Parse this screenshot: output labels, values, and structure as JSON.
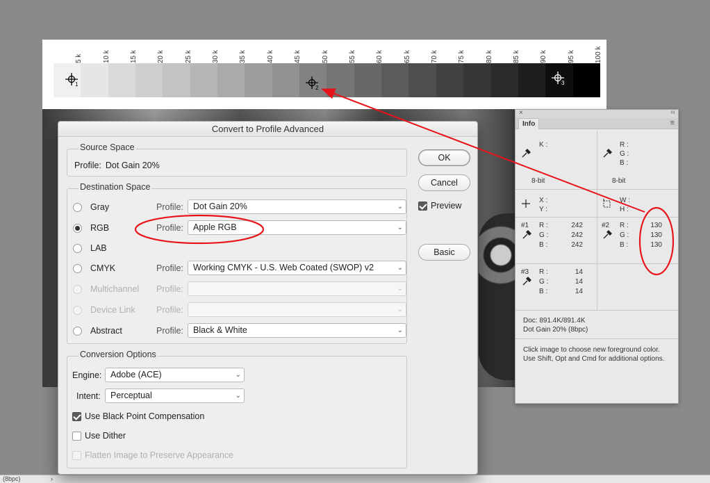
{
  "document": {
    "wedge_labels": [
      "5 k",
      "10 k",
      "15 k",
      "20 k",
      "25 k",
      "30 k",
      "35 k",
      "40 k",
      "45 k",
      "50 k",
      "55 k",
      "60 k",
      "65 k",
      "70 k",
      "75 k",
      "80 k",
      "85 k",
      "90 k",
      "95 k",
      "100 k"
    ],
    "wedge_grays": [
      "#f0f0f0",
      "#e6e6e6",
      "#dadada",
      "#cecece",
      "#c3c3c3",
      "#b6b6b6",
      "#aaaaaa",
      "#9d9d9d",
      "#919191",
      "#828282",
      "#757575",
      "#686868",
      "#5b5b5b",
      "#4e4e4e",
      "#424242",
      "#363636",
      "#2a2a2a",
      "#1e1e1e",
      "#0e0e0e",
      "#000000"
    ],
    "samplers": [
      "1",
      "2",
      "3"
    ]
  },
  "status_bar": {
    "text": "(8bpc)",
    "chevron": "›"
  },
  "dialog": {
    "title": "Convert to Profile Advanced",
    "source_space": {
      "title": "Source Space",
      "profile_label": "Profile:",
      "profile_value": "Dot Gain 20%"
    },
    "destination_space": {
      "title": "Destination Space",
      "profile_label": "Profile:",
      "options": [
        {
          "label": "Gray",
          "profile": "Dot Gain 20%",
          "selected": false,
          "enabled": true
        },
        {
          "label": "RGB",
          "profile": "Apple RGB",
          "selected": true,
          "enabled": true
        },
        {
          "label": "LAB",
          "profile": "",
          "selected": false,
          "enabled": true
        },
        {
          "label": "CMYK",
          "profile": "Working CMYK - U.S. Web Coated (SWOP) v2",
          "selected": false,
          "enabled": true
        },
        {
          "label": "Multichannel",
          "profile": "",
          "selected": false,
          "enabled": false
        },
        {
          "label": "Device Link",
          "profile": "",
          "selected": false,
          "enabled": false
        },
        {
          "label": "Abstract",
          "profile": "Black & White",
          "selected": false,
          "enabled": true
        }
      ]
    },
    "conversion_options": {
      "title": "Conversion Options",
      "engine_label": "Engine:",
      "engine_value": "Adobe (ACE)",
      "intent_label": "Intent:",
      "intent_value": "Perceptual",
      "black_point": "Use Black Point Compensation",
      "dither": "Use Dither",
      "flatten": "Flatten Image to Preserve Appearance"
    },
    "buttons": {
      "ok": "OK",
      "cancel": "Cancel",
      "preview": "Preview",
      "basic": "Basic"
    }
  },
  "info_panel": {
    "close": "×",
    "collapse": "‹‹",
    "tab": "Info",
    "menu": "≡",
    "k_label": "K :",
    "rgb_labels": [
      "R :",
      "G :",
      "B :"
    ],
    "bit_left": "8-bit",
    "bit_right": "8-bit",
    "x_label": "X :",
    "y_label": "Y :",
    "w_label": "W :",
    "h_label": "H :",
    "sampler1": {
      "id": "#1",
      "labels": [
        "R :",
        "G :",
        "B :"
      ],
      "values": [
        "242",
        "242",
        "242"
      ]
    },
    "sampler2": {
      "id": "#2",
      "labels": [
        "R :",
        "G :",
        "B :"
      ],
      "values": [
        "130",
        "130",
        "130"
      ]
    },
    "sampler3": {
      "id": "#3",
      "labels": [
        "R :",
        "G :",
        "B :"
      ],
      "values": [
        "14",
        "14",
        "14"
      ]
    },
    "doc_line": "Doc: 891.4K/891.4K",
    "profile_line": "Dot Gain 20% (8bpc)",
    "hint": "Click image to choose new foreground color.  Use Shift, Opt and Cmd for additional options."
  },
  "colors": {
    "annotation": "#e8141b"
  }
}
